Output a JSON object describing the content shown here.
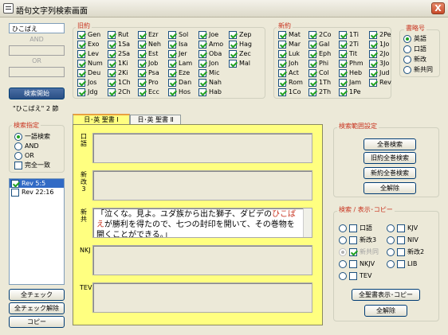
{
  "window": {
    "title": "語句文字列検索画面",
    "close_glyph": "X"
  },
  "search": {
    "term1": "ひこばえ",
    "and_label": "AND",
    "or_label": "OR",
    "start_button": "検索開始",
    "result_count": "\"ひこばえ\" 2 節"
  },
  "search_mode": {
    "title": "検索指定",
    "options": [
      "一語検索",
      "AND",
      "OR"
    ],
    "selected": "一語検索",
    "exact_label": "完全一致"
  },
  "results_list": [
    {
      "label": "Rev 5:5",
      "checked": true,
      "selected": true
    },
    {
      "label": "Rev 22:16",
      "checked": false,
      "selected": false
    }
  ],
  "bottom_buttons": {
    "check_all": "全チェック",
    "uncheck_all": "全チェック解除",
    "copy": "コピー"
  },
  "old_testament": {
    "title": "旧約",
    "books": [
      "Gen",
      "Exo",
      "Lev",
      "Num",
      "Deu",
      "Jos",
      "Jdg",
      "Rut",
      "1Sa",
      "2Sa",
      "1Ki",
      "2Ki",
      "1Ch",
      "2Ch",
      "Ezr",
      "Neh",
      "Est",
      "Job",
      "Psa",
      "Pro",
      "Ecc",
      "Sol",
      "Isa",
      "Jer",
      "Lam",
      "Eze",
      "Dan",
      "Hos",
      "Joe",
      "Amo",
      "Oba",
      "Jon",
      "Mic",
      "Nah",
      "Hab",
      "Zep",
      "Hag",
      "Zec",
      "Mal"
    ]
  },
  "new_testament": {
    "title": "新約",
    "books": [
      "Mat",
      "Mar",
      "Luk",
      "Joh",
      "Act",
      "Rom",
      "1Co",
      "2Co",
      "Gal",
      "Eph",
      "Phi",
      "Col",
      "1Th",
      "2Th",
      "1Ti",
      "2Ti",
      "Tit",
      "Phm",
      "Heb",
      "Jam",
      "1Pe",
      "2Pe",
      "1Jo",
      "2Jo",
      "3Jo",
      "Jud",
      "Rev"
    ]
  },
  "abbrev": {
    "title": "書略号",
    "options": [
      "英語",
      "口語",
      "新改",
      "新共同"
    ],
    "selected": "英語"
  },
  "tabs": [
    "日･英 聖書 Ⅰ",
    "日･英 聖書 Ⅱ"
  ],
  "panels": {
    "kogo_label": "口語",
    "shinkai_label": "新改3",
    "shinkyo_label": "新共",
    "nkj_label": "NKJ",
    "tev_label": "TEV",
    "shinkyo_text_before": "「泣くな。見よ。ユダ族から出た獅子、ダビデの",
    "shinkyo_text_highlight": "ひこばえ",
    "shinkyo_text_after": "が勝利を得たので、七つの封印を開いて、その巻物を開くことができる。」"
  },
  "scope": {
    "title": "検索範囲設定",
    "buttons": [
      "全巻検索",
      "旧約全巻検索",
      "新約全巻検索",
      "全解除"
    ]
  },
  "display": {
    "title": "検索 / 表示･コピー",
    "left_items": [
      {
        "label": "口語",
        "radio": false,
        "check": false,
        "disabled": false
      },
      {
        "label": "新改3",
        "radio": false,
        "check": false,
        "disabled": false
      },
      {
        "label": "新共同",
        "radio": true,
        "check": true,
        "disabled": true
      },
      {
        "label": "NKJV",
        "radio": false,
        "check": false,
        "disabled": false
      },
      {
        "label": "TEV",
        "radio": false,
        "check": false,
        "disabled": false
      }
    ],
    "right_items": [
      {
        "label": "KJV",
        "radio": false,
        "check": false
      },
      {
        "label": "NIV",
        "radio": false,
        "check": false
      },
      {
        "label": "新改2",
        "radio": false,
        "check": false
      },
      {
        "label": "LIB",
        "radio": false,
        "check": false
      }
    ],
    "show_copy_button": "全聖書表示･コピー",
    "clear_button": "全解除"
  },
  "colors": {
    "panel_yellow": "#ffff80",
    "highlight_red": "#c8321e",
    "check_green": "#21a121"
  }
}
